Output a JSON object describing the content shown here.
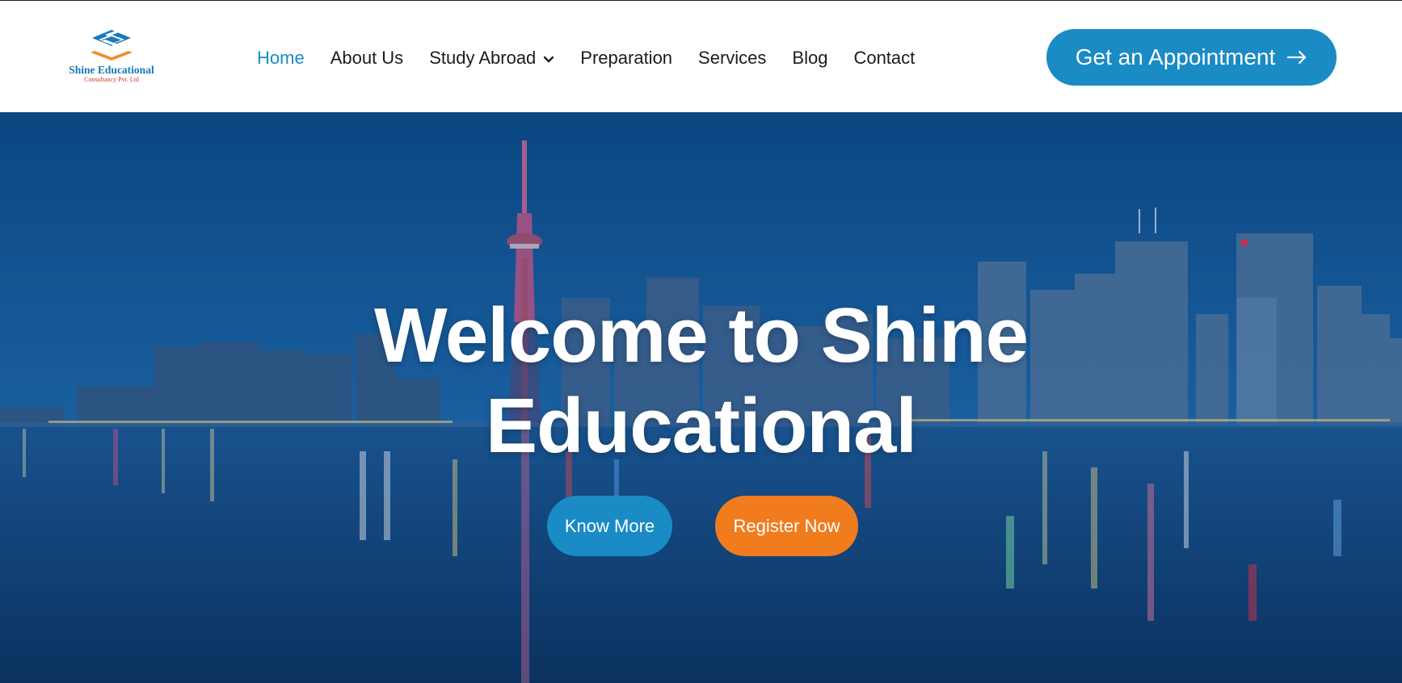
{
  "brand": {
    "name": "Shine Educational",
    "subtitle": "Consultancy Pvt. Ltd",
    "logo_icon": "stacked-book-logo-icon"
  },
  "nav": {
    "items": [
      {
        "label": "Home",
        "active": true
      },
      {
        "label": "About Us"
      },
      {
        "label": "Study Abroad",
        "has_dropdown": true,
        "icon": "chevron-down-icon"
      },
      {
        "label": "Preparation"
      },
      {
        "label": "Services"
      },
      {
        "label": "Blog"
      },
      {
        "label": "Contact"
      }
    ]
  },
  "cta": {
    "label": "Get an Appointment",
    "icon": "arrow-right-icon"
  },
  "hero": {
    "title_line1": "Welcome to Shine",
    "title_line2": "Educational",
    "buttons": {
      "know_more": "Know More",
      "register": "Register Now"
    },
    "background": "city skyline at night reflected on water"
  },
  "colors": {
    "primary": "#1a8bc4",
    "accent": "#f07c1e",
    "text": "#1c1c1c",
    "hero_overlay": "#0d4f8e"
  }
}
